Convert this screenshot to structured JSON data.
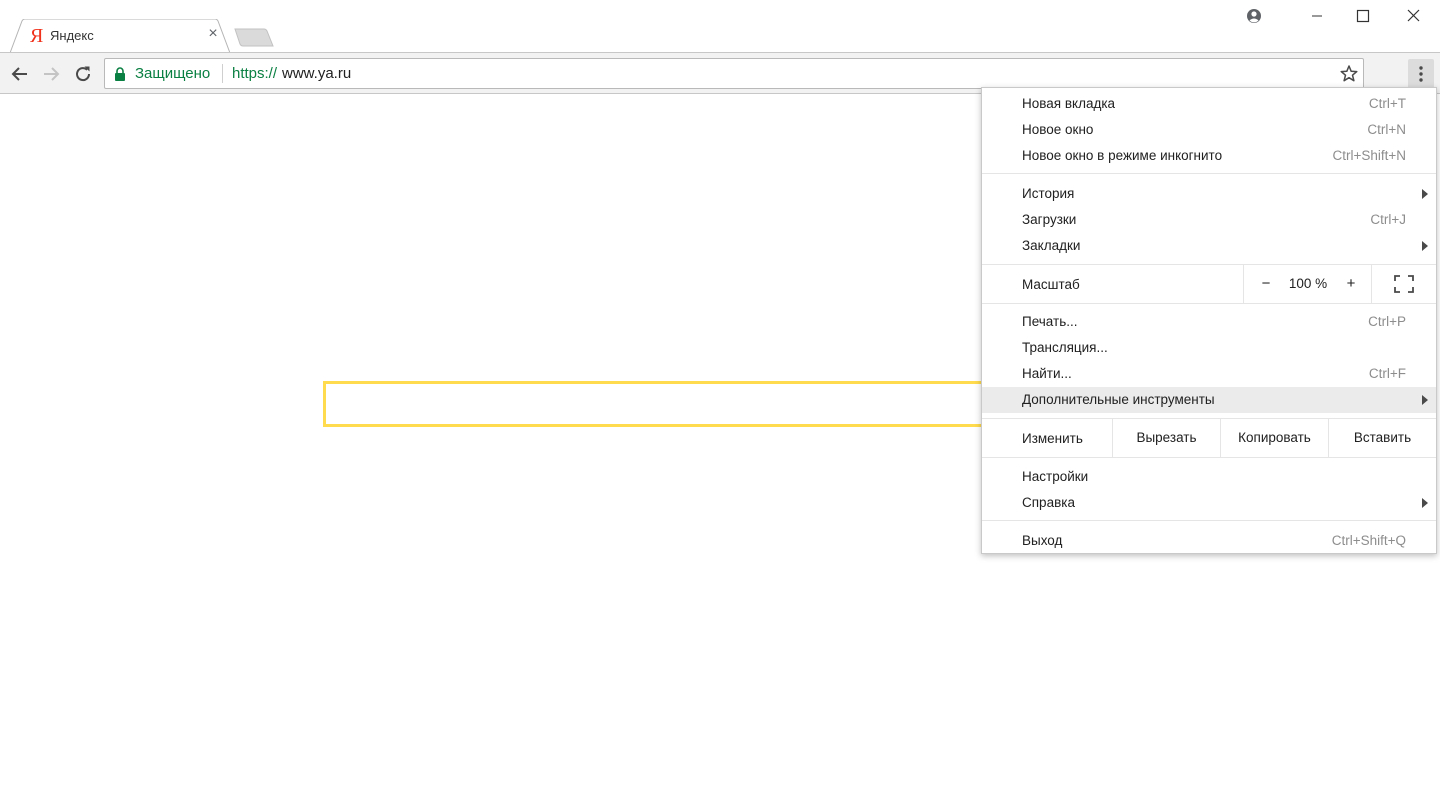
{
  "tabs": {
    "active": {
      "title": "Яндекс",
      "favicon": "Я"
    },
    "close_symbol": "×"
  },
  "toolbar": {
    "security_label": "Защищено",
    "url_scheme": "https://",
    "url_host": "www.ya.ru"
  },
  "menu": {
    "group1": [
      {
        "label": "Новая вкладка",
        "shortcut": "Ctrl+T"
      },
      {
        "label": "Новое окно",
        "shortcut": "Ctrl+N"
      },
      {
        "label": "Новое окно в режиме инкогнито",
        "shortcut": "Ctrl+Shift+N"
      }
    ],
    "group2": [
      {
        "label": "История",
        "shortcut": ""
      },
      {
        "label": "Загрузки",
        "shortcut": "Ctrl+J"
      },
      {
        "label": "Закладки",
        "shortcut": ""
      }
    ],
    "zoom": {
      "label": "Масштаб",
      "minus": "−",
      "value": "100 %",
      "plus": "+"
    },
    "group3": [
      {
        "label": "Печать...",
        "shortcut": "Ctrl+P"
      },
      {
        "label": "Трансляция...",
        "shortcut": ""
      },
      {
        "label": "Найти...",
        "shortcut": "Ctrl+F"
      },
      {
        "label": "Дополнительные инструменты",
        "shortcut": ""
      }
    ],
    "edit": {
      "label": "Изменить",
      "cut": "Вырезать",
      "copy": "Копировать",
      "paste": "Вставить"
    },
    "group4": [
      {
        "label": "Настройки",
        "shortcut": ""
      },
      {
        "label": "Справка",
        "shortcut": ""
      }
    ],
    "exit": {
      "label": "Выход",
      "shortcut": "Ctrl+Shift+Q"
    }
  },
  "colors": {
    "secure_green": "#0b8043",
    "yandex_red": "#f0311b",
    "search_border": "#ffdb4d",
    "menu_highlight": "#ebebeb"
  },
  "icons": [
    "profile-icon",
    "minimize-icon",
    "maximize-icon",
    "close-icon",
    "back-arrow-icon",
    "forward-arrow-icon",
    "reload-icon",
    "lock-icon",
    "star-icon",
    "more-vert-icon",
    "fullscreen-icon",
    "submenu-arrow-icon"
  ]
}
